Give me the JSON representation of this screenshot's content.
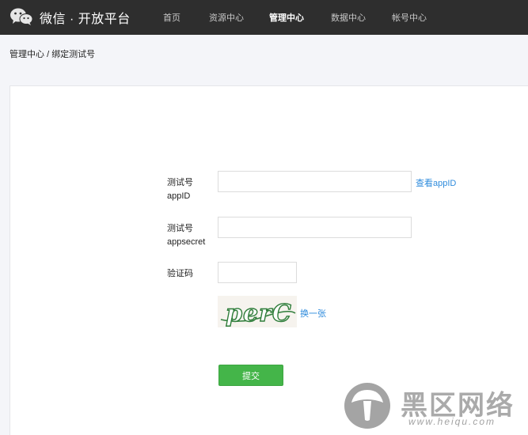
{
  "header": {
    "brand": "微信 · 开放平台",
    "nav": [
      {
        "label": "首页",
        "active": false
      },
      {
        "label": "资源中心",
        "active": false
      },
      {
        "label": "管理中心",
        "active": true
      },
      {
        "label": "数据中心",
        "active": false
      },
      {
        "label": "帐号中心",
        "active": false
      }
    ]
  },
  "breadcrumb": {
    "parent": "管理中心",
    "separator": "/",
    "current": "绑定测试号"
  },
  "form": {
    "appid_label_line1": "测试号",
    "appid_label_line2": "appID",
    "appid_value": "",
    "view_appid_link": "查看appID",
    "appsecret_label_line1": "测试号",
    "appsecret_label_line2": "appsecret",
    "appsecret_value": "",
    "captcha_label": "验证码",
    "captcha_value": "",
    "captcha_image_text": "perC",
    "refresh_captcha_link": "换一张",
    "submit_label": "提交"
  },
  "watermark": {
    "text": "黑区网络",
    "url": "www.heiqu.com"
  },
  "colors": {
    "topbar": "#2e2e2e",
    "submit": "#44b549",
    "link": "#2e8bdc"
  }
}
